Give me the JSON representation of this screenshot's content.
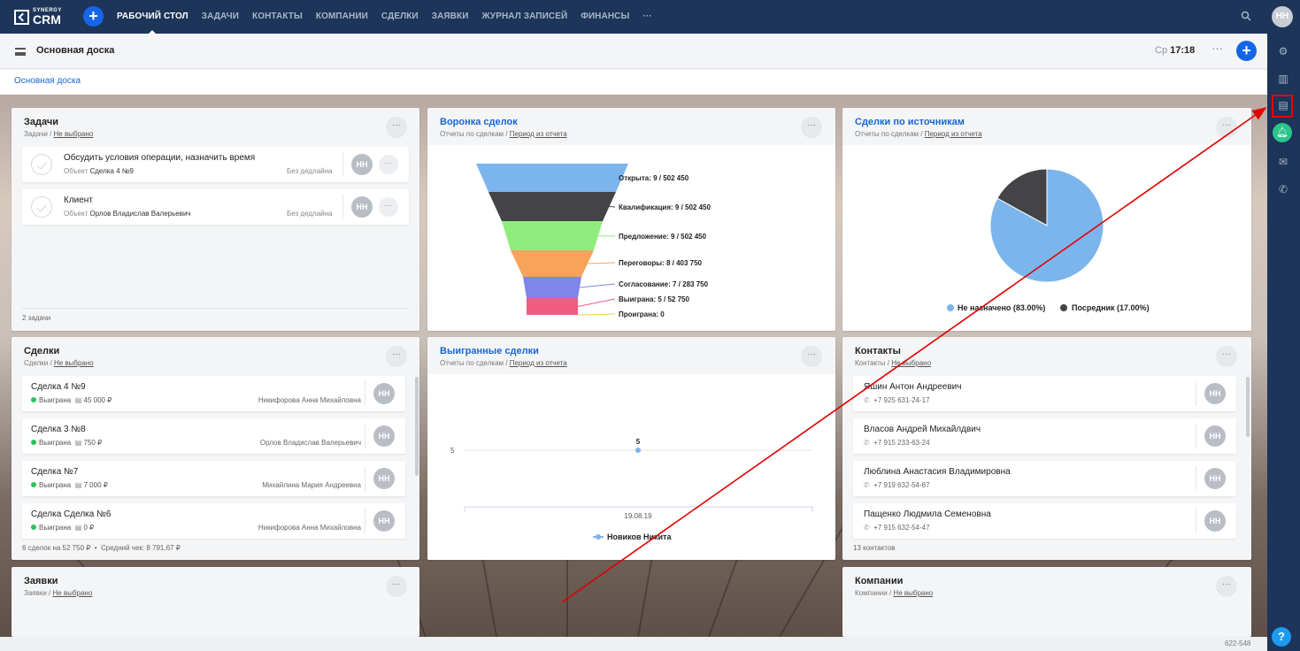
{
  "brand": {
    "small": "SYNERGY",
    "big": "CRM"
  },
  "nav": [
    "РАБОЧИЙ СТОЛ",
    "ЗАДАЧИ",
    "КОНТАКТЫ",
    "КОМПАНИИ",
    "СДЕЛКИ",
    "ЗАЯВКИ",
    "ЖУРНАЛ ЗАПИСЕЙ",
    "ФИНАНСЫ",
    "···"
  ],
  "user_initials": "НН",
  "header": {
    "title": "Основная доска",
    "day": "Ср",
    "time": "17:18",
    "menu": "···"
  },
  "breadcrumb": "Основная доска",
  "widgets": {
    "tasks": {
      "title": "Задачи",
      "sub_prefix": "Задачи / ",
      "sub_link": "Не выбрано",
      "menu": "···",
      "items": [
        {
          "name": "Обсудить условия операции, назначить время",
          "obj_label": "Объект",
          "obj_value": "Сделка 4 №9",
          "deadline": "Без дедлайна",
          "avatar": "НН",
          "more": "···"
        },
        {
          "name": "Клиент",
          "obj_label": "Объект",
          "obj_value": "Орлов Владислав Валерьевич",
          "deadline": "Без дедлайна",
          "avatar": "НН",
          "more": "···"
        }
      ],
      "footer": "2 задачи"
    },
    "funnel": {
      "title": "Воронка сделок",
      "sub_prefix": "Отчеты по сделкам / ",
      "sub_link": "Период из отчета",
      "menu": "···",
      "stages": [
        {
          "label": "Открыта: 9 / 502 450",
          "color": "#7cb5ec"
        },
        {
          "label": "Квалификация: 9 / 502 450",
          "color": "#434348"
        },
        {
          "label": "Предложение: 9 / 502 450",
          "color": "#90ed7d"
        },
        {
          "label": "Переговоры: 8 / 403 750",
          "color": "#f7a35c"
        },
        {
          "label": "Согласование: 7 / 283 750",
          "color": "#8085e9"
        },
        {
          "label": "Выиграна: 5 / 52 750",
          "color": "#f15c80"
        },
        {
          "label": "Проиграна: 0",
          "color": "#e4d354"
        }
      ]
    },
    "sources": {
      "title": "Сделки по источникам",
      "sub_prefix": "Отчеты по сделкам / ",
      "sub_link": "Период из отчета",
      "menu": "···",
      "chart_data": {
        "type": "pie",
        "slices": [
          {
            "name": "Не назначено",
            "value": 83.0,
            "color": "#7cb5ec"
          },
          {
            "name": "Посредник",
            "value": 17.0,
            "color": "#434348"
          }
        ]
      },
      "legend": [
        "Не назначено (83.00%)",
        "Посредник (17.00%)"
      ]
    },
    "deals": {
      "title": "Сделки",
      "sub_prefix": "Сделки / ",
      "sub_link": "Не выбрано",
      "menu": "···",
      "items": [
        {
          "name": "Сделка 4 №9",
          "status": "Выиграна",
          "amount": "45 000 ₽",
          "owner": "Никифорова Анна Михайловна",
          "avatar": "НН"
        },
        {
          "name": "Сделка 3 №8",
          "status": "Выиграна",
          "amount": "750 ₽",
          "owner": "Орлов Владислав Валерьевич",
          "avatar": "НН"
        },
        {
          "name": "Сделка №7",
          "status": "Выиграна",
          "amount": "7 000 ₽",
          "owner": "Михайлина Мария Андреевна",
          "avatar": "НН"
        },
        {
          "name": "Сделка Сделка №6",
          "status": "Выиграна",
          "amount": "0 ₽",
          "owner": "Никифорова Анна Михайловна",
          "avatar": "НН"
        }
      ],
      "footer_count": "6 сделок на 52 750 ₽",
      "footer_avg": "Средний чек: 8 791,67 ₽"
    },
    "won": {
      "title": "Выигранные сделки",
      "sub_prefix": "Отчеты по сделкам / ",
      "sub_link": "Период из отчета",
      "menu": "···",
      "chart_data": {
        "type": "line",
        "x": [
          "19.08.19"
        ],
        "series": [
          {
            "name": "Новиков Никита",
            "values": [
              5
            ],
            "color": "#7cb5ec"
          }
        ],
        "ytick": "5",
        "data_label": "5"
      }
    },
    "contacts": {
      "title": "Контакты",
      "sub_prefix": "Контакты / ",
      "sub_link": "Не выбрано",
      "menu": "···",
      "items": [
        {
          "name": "Яшин Антон Андреевич",
          "phone": "+7 925 631-24-17",
          "avatar": "НН"
        },
        {
          "name": "Власов Андрей Михайлдвич",
          "phone": "+7 915 233-63-24",
          "avatar": "НН"
        },
        {
          "name": "Люблина Анастасия Владимировна",
          "phone": "+7 919 632-54-87",
          "avatar": "НН"
        },
        {
          "name": "Пащенко Людмила Семеновна",
          "phone": "+7 915 632-54-47",
          "avatar": "НН"
        }
      ],
      "footer": "13 контактов"
    },
    "requests": {
      "title": "Заявки",
      "sub_prefix": "Заявки / ",
      "sub_link": "Не выбрано",
      "menu": "···"
    },
    "companies": {
      "title": "Компании",
      "sub_prefix": "Компании / ",
      "sub_link": "Не выбрано",
      "menu": "···"
    }
  },
  "footer_number": "622-548",
  "colors": {
    "nav_bg": "#1c3559",
    "accent": "#1565e8",
    "link": "#1a66d2",
    "highlight": "#e00000"
  }
}
